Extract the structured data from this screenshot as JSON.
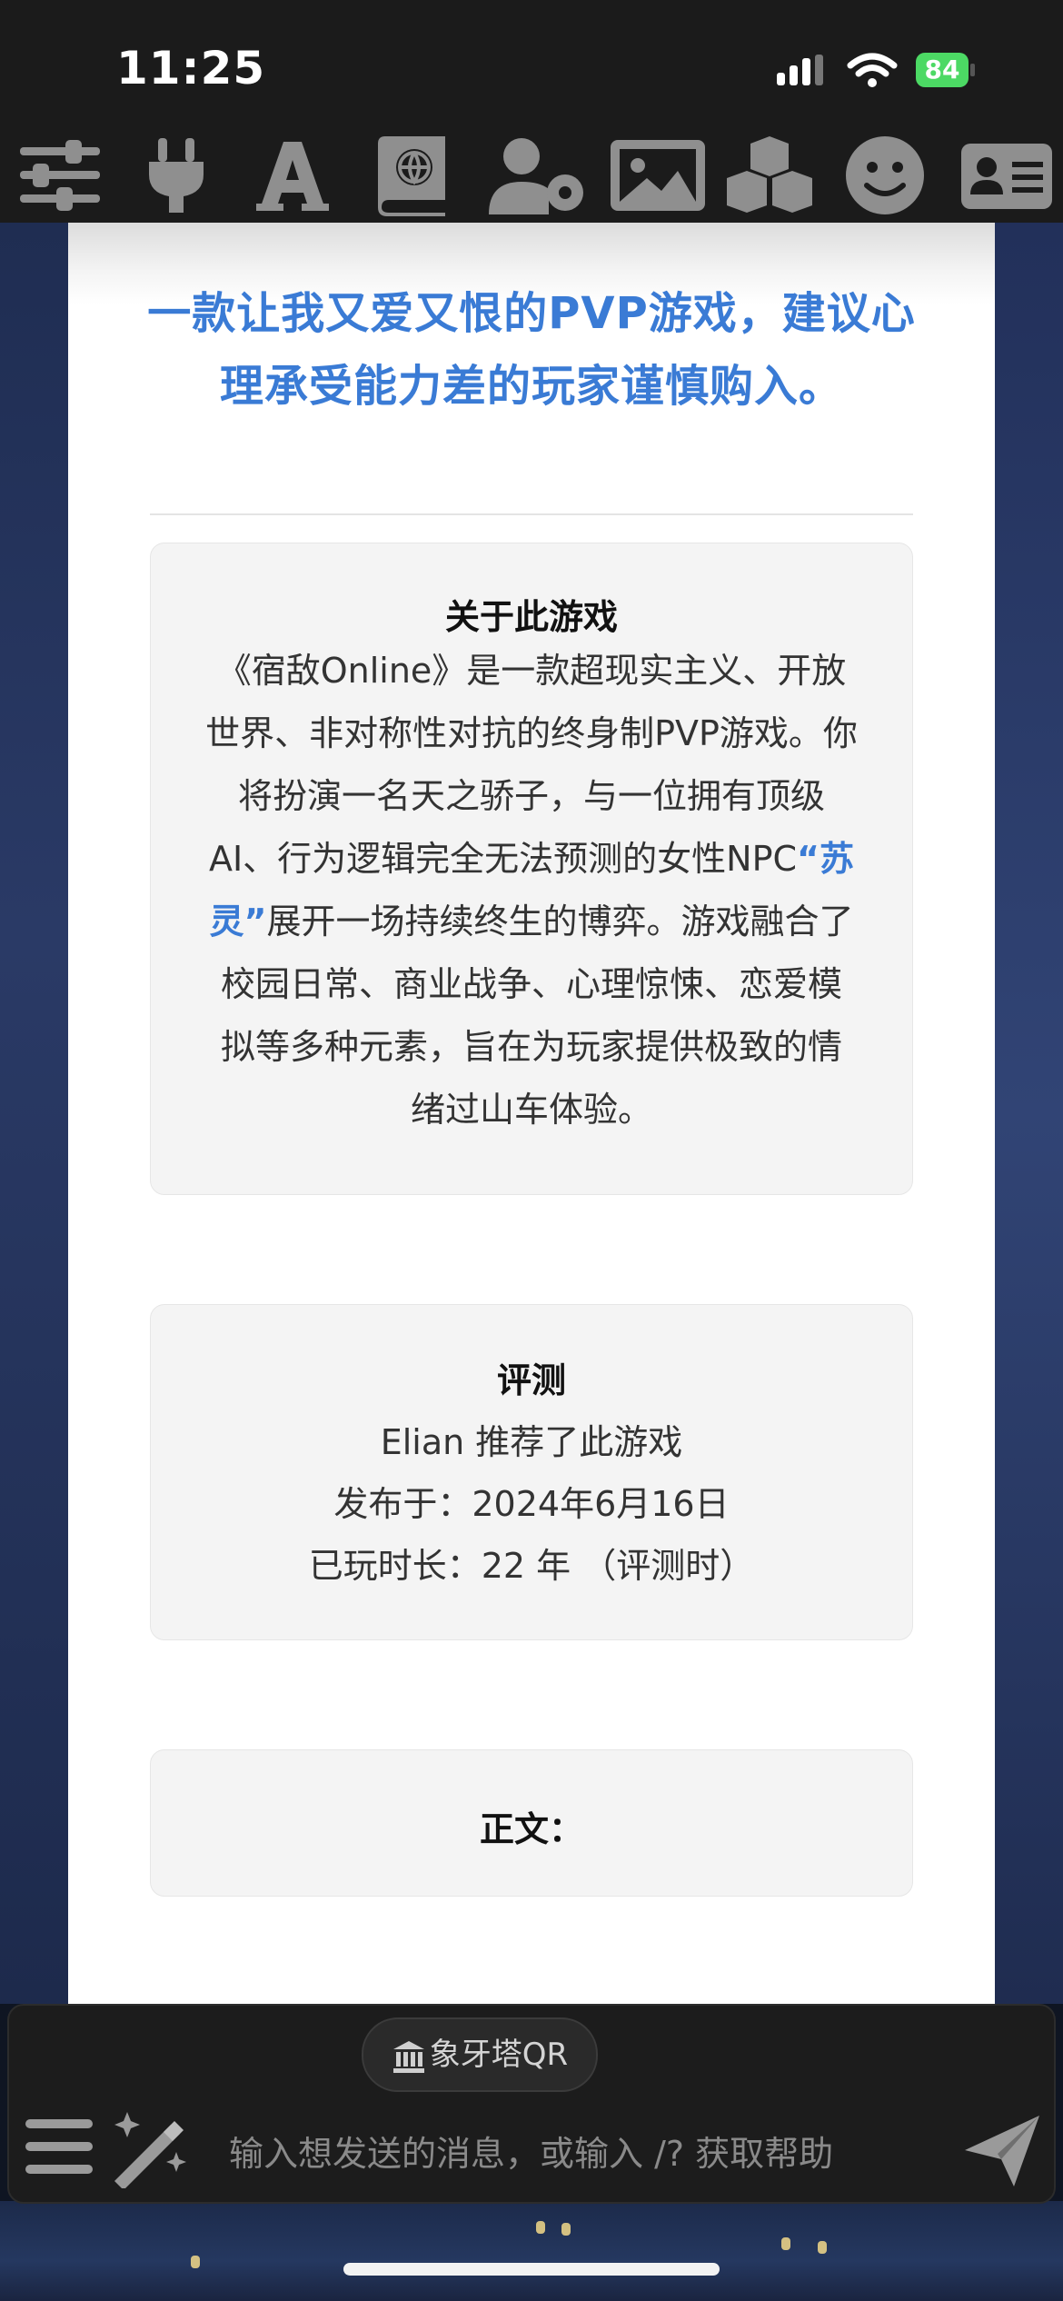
{
  "status": {
    "time": "11:25",
    "battery": "84"
  },
  "toolbar": {
    "icons": [
      "sliders-icon",
      "plug-icon",
      "font-icon",
      "book-globe-icon",
      "user-gear-icon",
      "image-icon",
      "cubes-icon",
      "smile-icon",
      "id-card-icon"
    ]
  },
  "content": {
    "headline": "一款让我又爱又恨的PVP游戏，建议心理承受能力差的玩家谨慎购入。",
    "about": {
      "title": "关于此游戏",
      "text_before": "《宿敌Online》是一款超现实主义、开放世界、非对称性对抗的终身制PVP游戏。你将扮演一名天之骄子，与一位拥有顶级AI、行为逻辑完全无法预测的女性NPC",
      "npc_name": "“苏灵”",
      "text_after": "展开一场持续终生的博弈。游戏融合了校园日常、商业战争、心理惊悚、恋爱模拟等多种元素，旨在为玩家提供极致的情绪过山车体验。"
    },
    "review": {
      "title": "评测",
      "recommend": "Elian 推荐了此游戏",
      "published": "发布于：2024年6月16日",
      "playtime": "已玩时长：22 年 （评测时）"
    },
    "body_label": "正文："
  },
  "chat": {
    "qr_chip": "象牙塔QR",
    "input_placeholder": "输入想发送的消息，或输入 /? 获取帮助"
  },
  "colors": {
    "accent": "#3a7bd5",
    "card_bg": "#f4f4f4",
    "bar_bg": "#1b1b1b"
  }
}
